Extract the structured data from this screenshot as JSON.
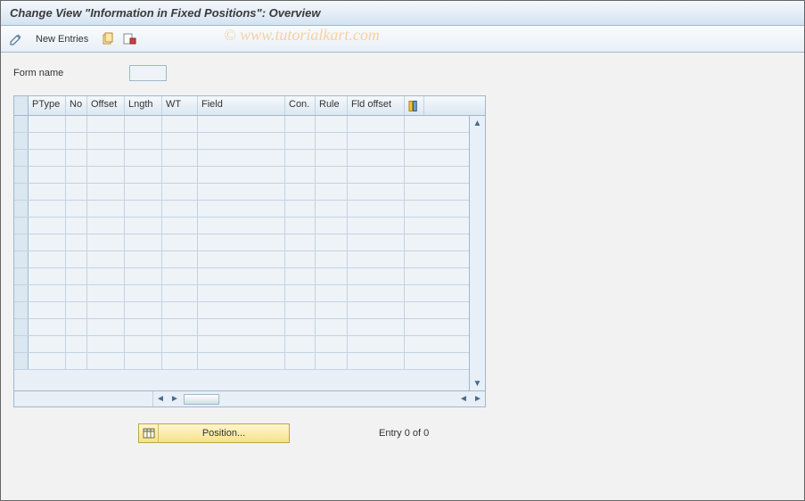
{
  "titlebar": {
    "title": "Change View \"Information in Fixed Positions\": Overview"
  },
  "toolbar": {
    "new_entries_label": "New Entries"
  },
  "watermark": "© www.tutorialkart.com",
  "form": {
    "label": "Form name",
    "value": ""
  },
  "grid": {
    "columns": [
      "PType",
      "No",
      "Offset",
      "Lngth",
      "WT",
      "Field",
      "Con.",
      "Rule",
      "Fld offset"
    ],
    "rows": 15
  },
  "footer": {
    "position_label": "Position...",
    "entry_text": "Entry 0 of 0"
  }
}
